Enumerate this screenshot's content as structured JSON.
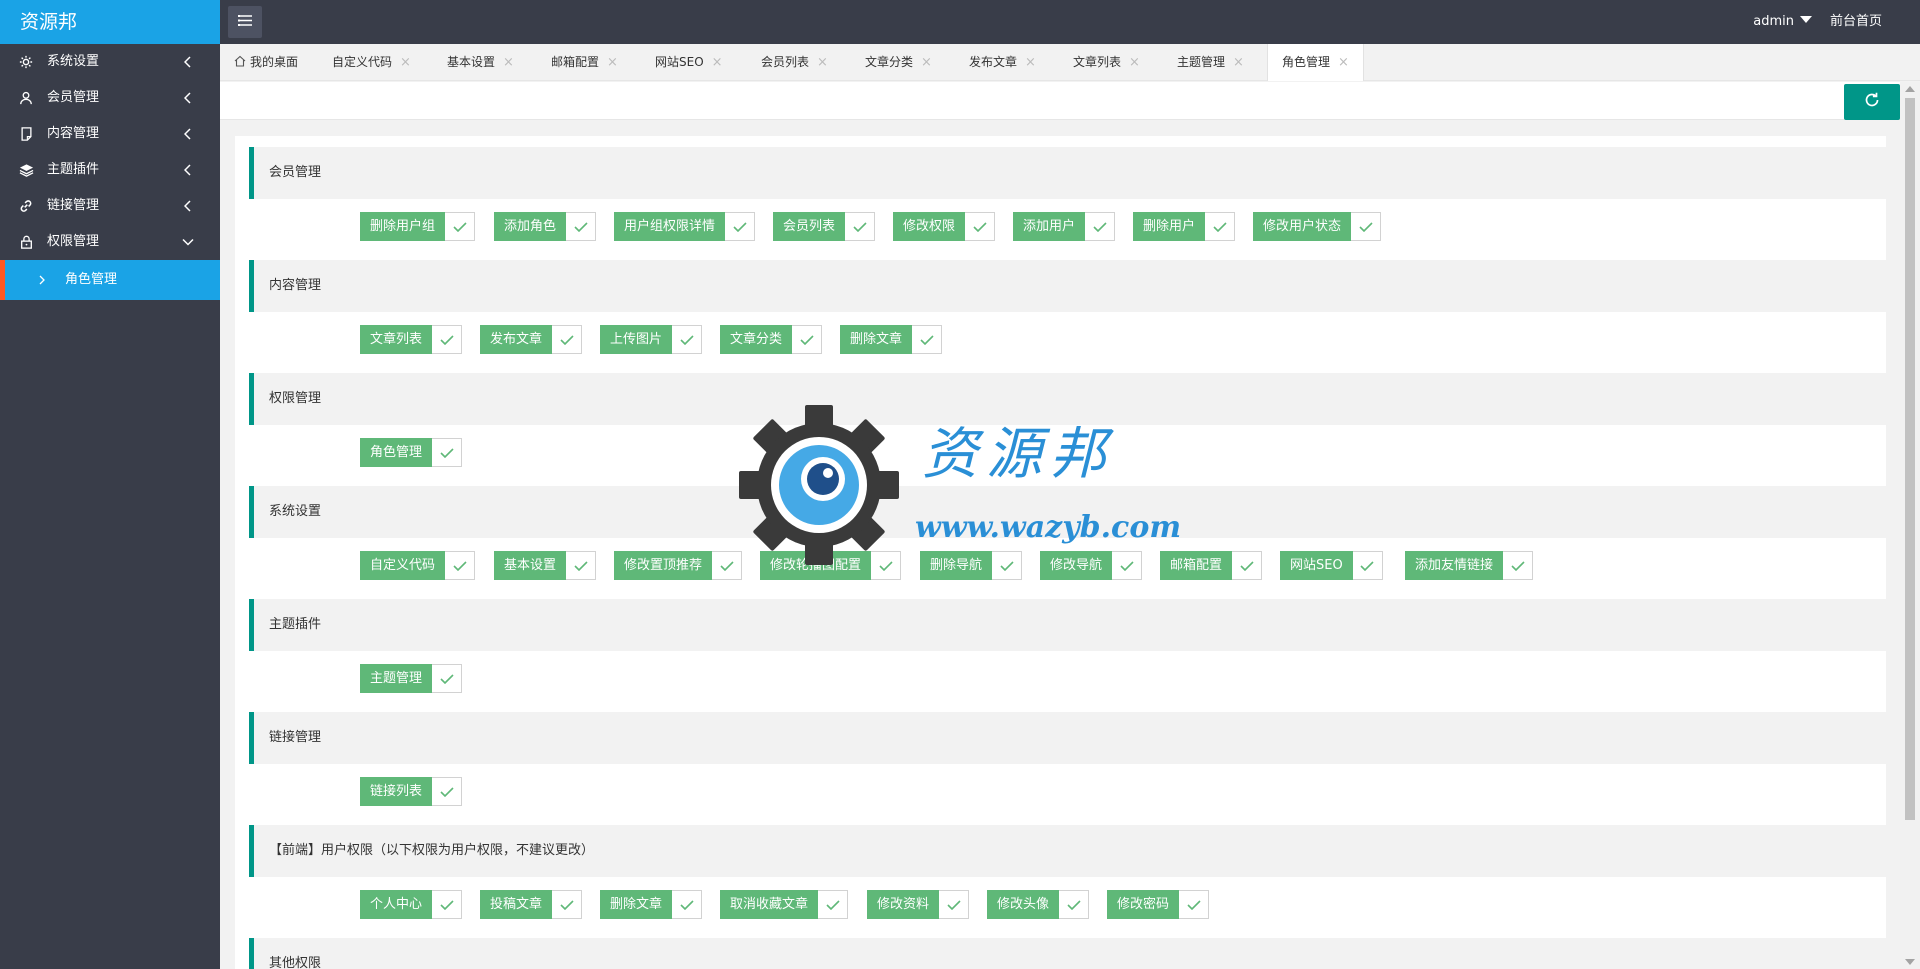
{
  "app": {
    "logo": "资源邦"
  },
  "header": {
    "user": "admin",
    "home_link": "前台首页"
  },
  "sidebar": {
    "items": [
      {
        "label": "系统设置",
        "icon": "gear-icon"
      },
      {
        "label": "会员管理",
        "icon": "user-icon"
      },
      {
        "label": "内容管理",
        "icon": "document-icon"
      },
      {
        "label": "主题插件",
        "icon": "layers-icon"
      },
      {
        "label": "链接管理",
        "icon": "link-icon"
      },
      {
        "label": "权限管理",
        "icon": "lock-icon"
      }
    ],
    "sub_item": {
      "label": "角色管理"
    }
  },
  "tabs": [
    {
      "label": "我的桌面"
    },
    {
      "label": "自定义代码"
    },
    {
      "label": "基本设置"
    },
    {
      "label": "邮箱配置"
    },
    {
      "label": "网站SEO"
    },
    {
      "label": "会员列表"
    },
    {
      "label": "文章分类"
    },
    {
      "label": "发布文章"
    },
    {
      "label": "文章列表"
    },
    {
      "label": "主题管理"
    },
    {
      "label": "角色管理"
    }
  ],
  "tab_close_glyph": "×",
  "sections": [
    {
      "title": "会员管理",
      "items": [
        "删除用户组",
        "添加角色",
        "用户组权限详情",
        "会员列表",
        "修改权限",
        "添加用户",
        "删除用户",
        "修改用户状态"
      ]
    },
    {
      "title": "内容管理",
      "items": [
        "文章列表",
        "发布文章",
        "上传图片",
        "文章分类",
        "删除文章"
      ]
    },
    {
      "title": "权限管理",
      "items": [
        "角色管理"
      ]
    },
    {
      "title": "系统设置",
      "items": [
        "自定义代码",
        "基本设置",
        "修改置顶推荐",
        "修改轮播图配置",
        "删除导航",
        "修改导航",
        "邮箱配置",
        "网站SEO",
        "添加友情链接"
      ]
    },
    {
      "title": "主题插件",
      "items": [
        "主题管理"
      ]
    },
    {
      "title": "链接管理",
      "items": [
        "链接列表"
      ]
    },
    {
      "title": "【前端】用户权限（以下权限为用户权限，不建议更改）",
      "items": [
        "个人中心",
        "投稿文章",
        "删除文章",
        "取消收藏文章",
        "修改资料",
        "修改头像",
        "修改密码"
      ]
    },
    {
      "title": "其他权限",
      "items": []
    }
  ],
  "watermark": {
    "brand": "资源邦",
    "url": "www.wazyb.com"
  },
  "colors": {
    "accent": "#1aa3e6",
    "teal": "#009688",
    "green": "#5fb878",
    "sidebar": "#393d49"
  }
}
